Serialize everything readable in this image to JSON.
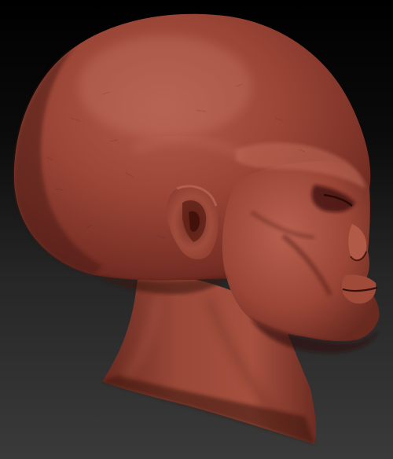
{
  "scene": {
    "subject": "alien-head-sculpt",
    "view": "profile-right",
    "material_color": "#8a3a2e",
    "background_top": "#000000",
    "background_bottom": "#3a3a3a"
  }
}
